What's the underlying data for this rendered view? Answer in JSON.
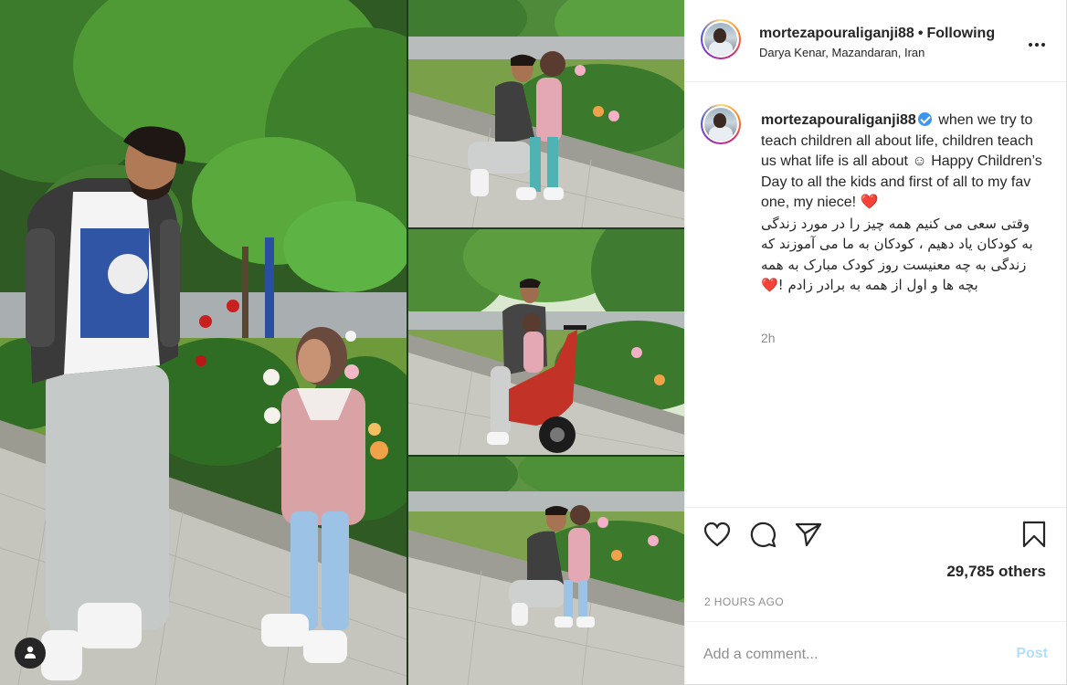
{
  "post": {
    "username": "mortezapouraliganji88",
    "follow_status": "Following",
    "location": "Darya Kenar, Mazandaran, Iran",
    "verified": true,
    "caption_en": "when we try to teach children all about life, children teach us what life is all about ☺ Happy Children’s Day to all the kids and first of all to my fav one, my niece! ❤️",
    "caption_fa": "وقتی سعی می کنیم همه چیز را در مورد زندگی به کودکان یاد دهیم ، کودکان به ما می آموزند که زندگی به چه معنیست روز کودک مبارک به همه بچه ها و اول از همه به برادر زادم !❤️",
    "caption_time": "2h",
    "likes_text": "29,785 others",
    "timestamp": "2 HOURS AGO"
  },
  "comment": {
    "placeholder": "Add a comment...",
    "post_label": "Post"
  },
  "icons": {
    "more": "more-options-icon",
    "like": "heart-icon",
    "comment": "comment-icon",
    "share": "share-icon",
    "save": "bookmark-icon",
    "tags": "user-tag-icon"
  },
  "colors": {
    "link_blue": "#3897f0",
    "post_disabled": "#b2dffc",
    "muted": "#8e8e8e",
    "text": "#262626"
  }
}
